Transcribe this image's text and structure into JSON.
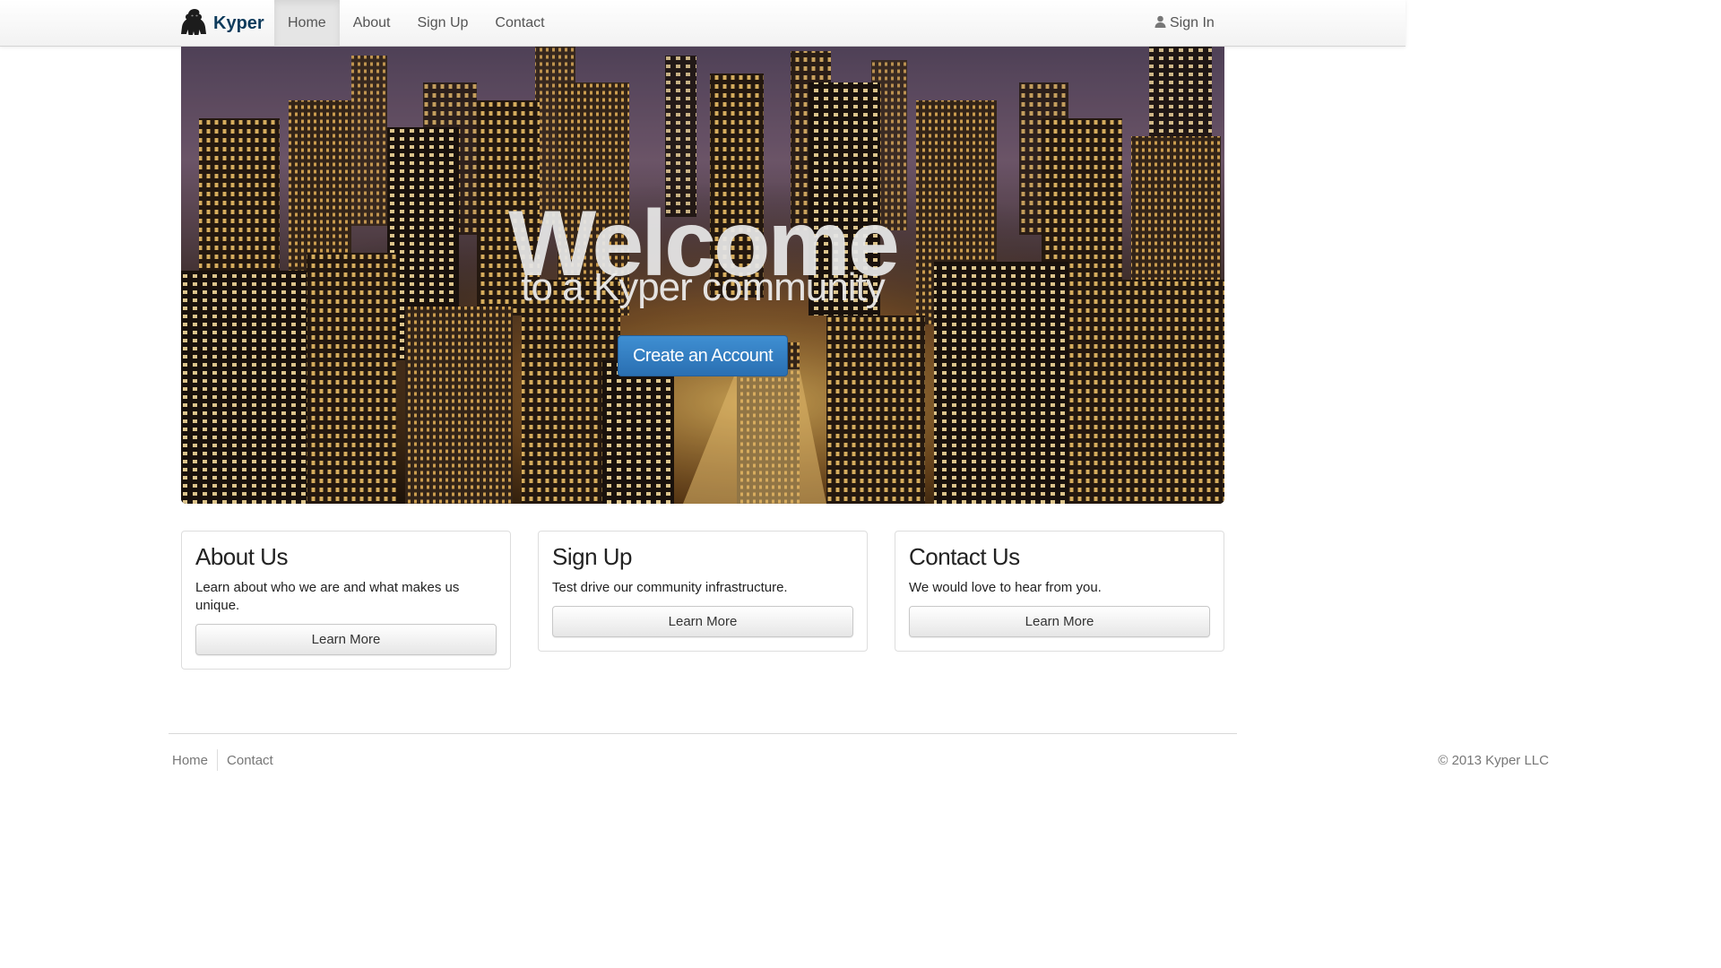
{
  "brand": {
    "name": "Kyper"
  },
  "nav": {
    "items": [
      {
        "label": "Home",
        "active": true
      },
      {
        "label": "About"
      },
      {
        "label": "Sign Up"
      },
      {
        "label": "Contact"
      }
    ],
    "signin_label": "Sign In"
  },
  "hero": {
    "title": "Welcome",
    "subtitle": "to a Kyper community",
    "cta_label": "Create an Account"
  },
  "cards": [
    {
      "title": "About Us",
      "text": "Learn about who we are and what makes us unique.",
      "button": "Learn More"
    },
    {
      "title": "Sign Up",
      "text": "Test drive our community infrastructure.",
      "button": "Learn More"
    },
    {
      "title": "Contact Us",
      "text": "We would love to hear from you.",
      "button": "Learn More"
    }
  ],
  "footer": {
    "links": [
      "Home",
      "Contact"
    ],
    "copyright": "© 2013 Kyper LLC"
  },
  "colors": {
    "brand": "#0e3b5c",
    "primary_button": "#337ab7",
    "nav_active_bg": "#e5e5e5"
  },
  "icons": {
    "brand": "gorilla-logo-icon",
    "signin": "user-icon"
  }
}
